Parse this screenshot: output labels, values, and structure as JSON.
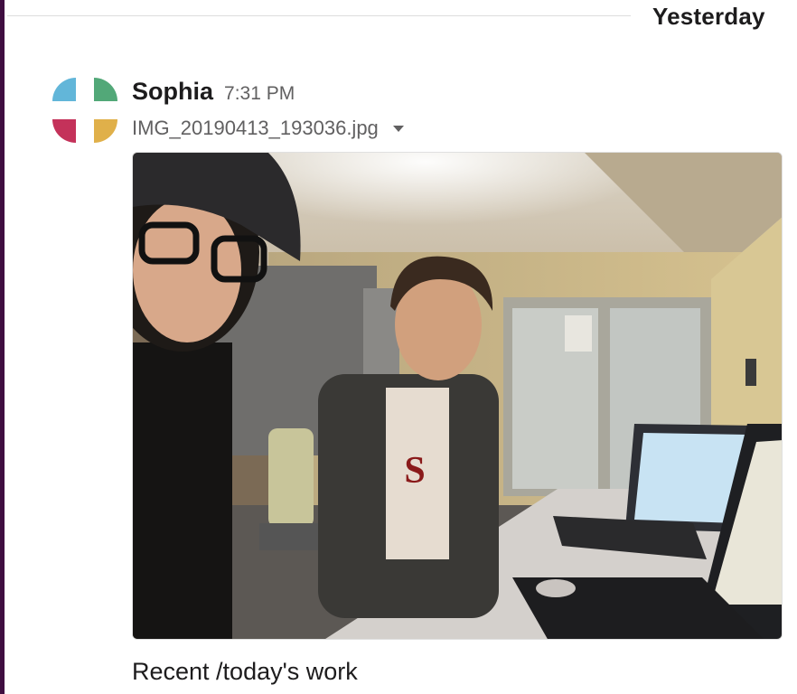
{
  "divider": {
    "date_label": "Yesterday"
  },
  "message": {
    "author": "Sophia",
    "time": "7:31 PM",
    "avatar_icon": "workspace-pinwheel-icon",
    "avatar_colors": [
      "#62b6d9",
      "#52a878",
      "#c4325a",
      "#e0b04a"
    ],
    "file": {
      "name": "IMG_20190413_193036.jpg",
      "menu_icon": "caret-down-icon"
    },
    "image_description_icon": "photo-attachment",
    "caption": "Recent /today's work"
  },
  "colors": {
    "sidebar_edge": "#3f0e40",
    "text_primary": "#1d1c1d",
    "text_secondary": "#616061"
  }
}
